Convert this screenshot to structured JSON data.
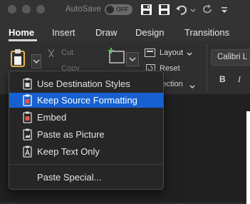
{
  "titlebar": {
    "autosave_label": "AutoSave",
    "autosave_state": "OFF",
    "icons": [
      "save-as-icon",
      "save-icon",
      "undo-icon",
      "redo-icon",
      "more-icon"
    ]
  },
  "ribbon_tabs": [
    {
      "label": "Home",
      "active": true
    },
    {
      "label": "Insert",
      "active": false
    },
    {
      "label": "Draw",
      "active": false
    },
    {
      "label": "Design",
      "active": false
    },
    {
      "label": "Transitions",
      "active": false
    }
  ],
  "clipboard": {
    "cut_label": "Cut",
    "copy_label": "Copy"
  },
  "slides": {
    "layout_label": "Layout",
    "reset_label": "Reset",
    "section_label": "Section"
  },
  "font": {
    "name": "Calibri L",
    "bold_label": "B",
    "italic_label": "I"
  },
  "paste_menu": {
    "items": [
      {
        "label": "Use Destination Styles",
        "icon": "clipboard-destination-icon",
        "selected": false
      },
      {
        "label": "Keep Source Formatting",
        "icon": "clipboard-source-icon",
        "selected": true
      },
      {
        "label": "Embed",
        "icon": "clipboard-embed-icon",
        "selected": false
      },
      {
        "label": "Paste as Picture",
        "icon": "clipboard-picture-icon",
        "selected": false
      },
      {
        "label": "Keep Text Only",
        "icon": "clipboard-text-icon",
        "selected": false
      }
    ],
    "paste_special_label": "Paste Special..."
  },
  "colors": {
    "accent": "#1660d1",
    "background": "#2b2b2b",
    "menu_background": "#262626"
  }
}
